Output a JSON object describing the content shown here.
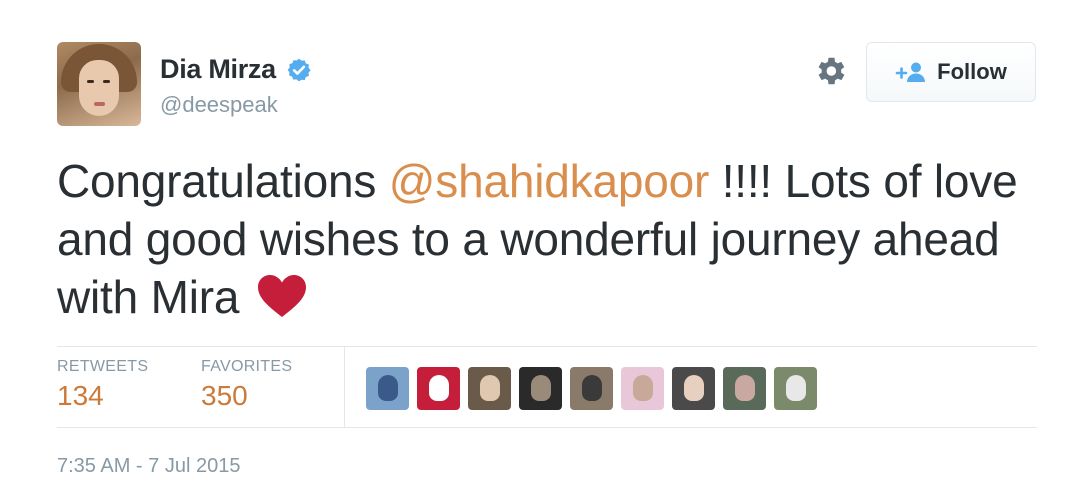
{
  "user": {
    "display_name": "Dia Mirza",
    "handle": "@deespeak",
    "verified": true
  },
  "actions": {
    "settings_icon": "gear-icon",
    "follow_label": "Follow",
    "follow_icon": "add-user-icon"
  },
  "tweet": {
    "text_before": "Congratulations ",
    "mention": "@shahidkapoor",
    "text_after": " !!!! Lots of love and good wishes to a wonderful journey ahead with Mira",
    "emoji": "heart",
    "heart_color": "#c41e3a",
    "mention_color": "#d98e4d"
  },
  "stats": {
    "retweets_label": "RETWEETS",
    "retweets_value": "134",
    "favorites_label": "FAVORITES",
    "favorites_value": "350"
  },
  "favoriters": [
    {
      "bg": "#7ba3c9",
      "fg": "#3a5a8a"
    },
    {
      "bg": "#c41e3a",
      "fg": "#ffffff"
    },
    {
      "bg": "#6a5a4a",
      "fg": "#e0c8b0"
    },
    {
      "bg": "#2a2a2a",
      "fg": "#9a8a7a"
    },
    {
      "bg": "#8a7a6a",
      "fg": "#3a3a3a"
    },
    {
      "bg": "#e8c8d8",
      "fg": "#c8a898"
    },
    {
      "bg": "#4a4a4a",
      "fg": "#e8d0c0"
    },
    {
      "bg": "#5a6a5a",
      "fg": "#c8a8a0"
    },
    {
      "bg": "#7a8a6a",
      "fg": "#e8e8e8"
    }
  ],
  "timestamp": "7:35 AM - 7 Jul 2015"
}
